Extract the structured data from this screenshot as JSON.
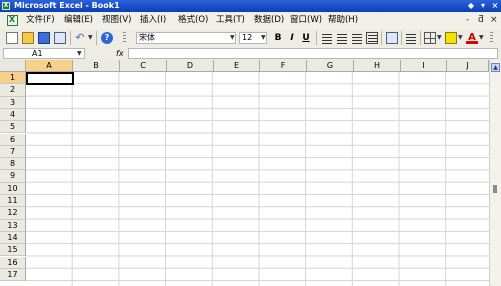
{
  "window": {
    "title": "Microsoft Excel - Book1",
    "controls": [
      "◆",
      "▾",
      "×"
    ]
  },
  "menu": {
    "items": [
      "文件(F)",
      "编辑(E)",
      "视图(V)",
      "插入(I)",
      "格式(O)",
      "工具(T)",
      "数据(D)",
      "窗口(W)",
      "帮助(H)"
    ],
    "controls": [
      "-",
      "ƌ",
      "×"
    ]
  },
  "toolbar": {
    "font_name": "宋体",
    "font_size": "12",
    "bold": "B",
    "italic": "I",
    "underline": "U",
    "font_color_letter": "A",
    "help": "?"
  },
  "formula_bar": {
    "name_box": "A1",
    "fx": "fx",
    "value": ""
  },
  "sheet": {
    "columns": [
      "A",
      "B",
      "C",
      "D",
      "E",
      "F",
      "G",
      "H",
      "I",
      "J"
    ],
    "rows": [
      "1",
      "2",
      "3",
      "4",
      "5",
      "6",
      "7",
      "8",
      "9",
      "10",
      "11",
      "12",
      "13",
      "14",
      "15",
      "16",
      "17"
    ],
    "active_cell": "A1"
  },
  "colors": {
    "title_bar": "#0a3fb8",
    "active_header": "#f7d08a"
  }
}
